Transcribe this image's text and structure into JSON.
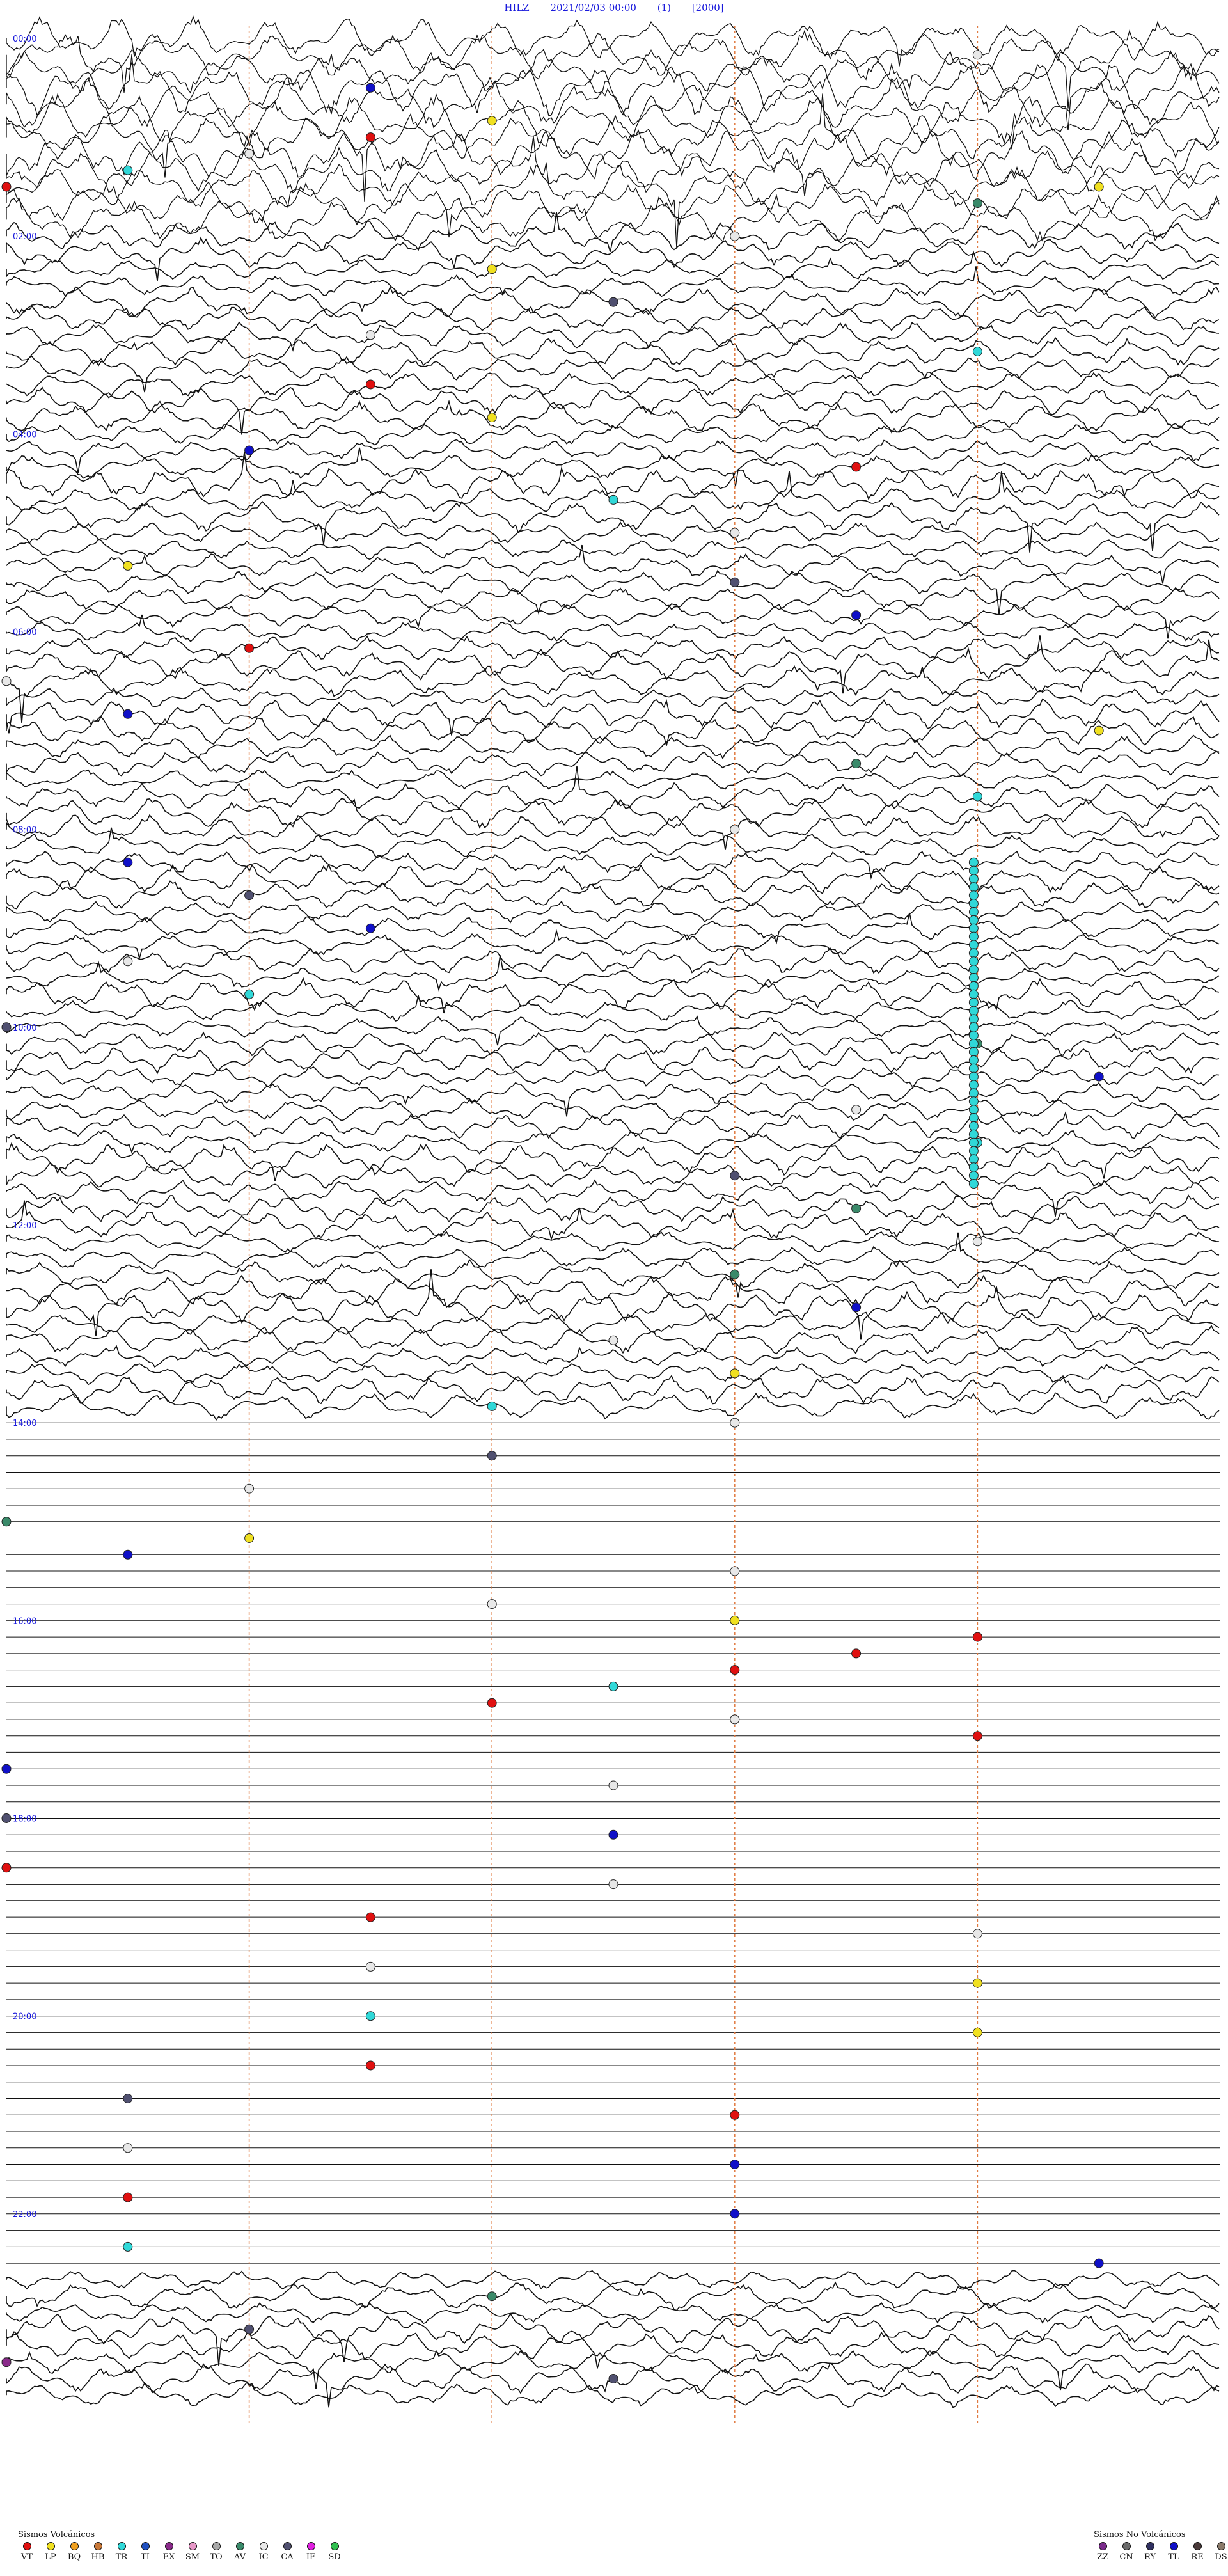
{
  "header": {
    "station": "HILZ",
    "datetime": "2021/02/03 00:00",
    "component": "(1)",
    "gain": "[2000]"
  },
  "chart_data": {
    "type": "scatter",
    "description_type": "helicorder",
    "title": "HILZ 2021/02/03 00:00 (1) [2000]",
    "rows": 144,
    "minutes_per_row": 10,
    "time_labels": [
      "00:00",
      "02:00",
      "04:00",
      "06:00",
      "08:00",
      "10:00",
      "12:00",
      "14:00",
      "16:00",
      "18:00",
      "20:00",
      "22:00"
    ],
    "time_label_color": "#1a1adc",
    "minute_marker_positions": [
      0.2,
      0.4,
      0.6,
      0.8
    ],
    "minute_marker_color": "#e07a40",
    "trace_color": "#111111",
    "active_trace_hours": [
      [
        0,
        14
      ],
      [
        22.6,
        24
      ]
    ],
    "flat_trace_hours": [
      14,
      22.6
    ],
    "event_counts_by_class": {
      "VT": 33,
      "LP": 20,
      "BQ": 0,
      "HB": 0,
      "TR": 95,
      "TI": 0,
      "EX": 2,
      "SM": 0,
      "TO": 0,
      "AV": 9,
      "IC": 54,
      "CA": 10,
      "IF": 0,
      "SD": 0,
      "ZZ": 0,
      "CN": 0,
      "RY": 0,
      "TL": 18,
      "RE": 0,
      "DS": 0
    },
    "events": [
      {
        "t": 0.3,
        "cls": "IC"
      },
      {
        "t": 0.55,
        "cls": "TL"
      },
      {
        "t": 0.9,
        "cls": "LP"
      },
      {
        "t": 1.05,
        "cls": "VT"
      },
      {
        "t": 1.2,
        "cls": "IC"
      },
      {
        "t": 1.35,
        "cls": "TR"
      },
      {
        "t": 1.5,
        "cls": "VT"
      },
      {
        "t": 1.65,
        "cls": "LP"
      },
      {
        "t": 1.8,
        "cls": "AV"
      },
      {
        "t": 2.1,
        "cls": "IC"
      },
      {
        "t": 2.4,
        "cls": "LP"
      },
      {
        "t": 2.75,
        "cls": "CA"
      },
      {
        "t": 3.05,
        "cls": "IC"
      },
      {
        "t": 3.3,
        "cls": "TR"
      },
      {
        "t": 3.55,
        "cls": "VT"
      },
      {
        "t": 3.9,
        "cls": "LP"
      },
      {
        "t": 4.2,
        "cls": "TL"
      },
      {
        "t": 4.45,
        "cls": "VT"
      },
      {
        "t": 4.75,
        "cls": "TR"
      },
      {
        "t": 5.1,
        "cls": "IC"
      },
      {
        "t": 5.35,
        "cls": "LP"
      },
      {
        "t": 5.6,
        "cls": "CA"
      },
      {
        "t": 5.95,
        "cls": "TL"
      },
      {
        "t": 6.2,
        "cls": "VT"
      },
      {
        "t": 6.5,
        "cls": "IC"
      },
      {
        "t": 6.85,
        "cls": "TL"
      },
      {
        "t": 7.15,
        "cls": "LP"
      },
      {
        "t": 7.45,
        "cls": "AV"
      },
      {
        "t": 7.8,
        "cls": "TR"
      },
      {
        "t": 8.1,
        "cls": "IC"
      },
      {
        "t": 8.35,
        "cls": "TL"
      },
      {
        "t": 8.7,
        "cls": "CA"
      },
      {
        "t": 9.05,
        "cls": "TL"
      },
      {
        "t": 9.35,
        "cls": "IC"
      },
      {
        "t": 9.7,
        "cls": "TR"
      },
      {
        "t": 10.0,
        "cls": "CA"
      },
      {
        "t": 10.3,
        "cls": "AV"
      },
      {
        "t": 10.65,
        "cls": "TL"
      },
      {
        "t": 10.95,
        "cls": "IC"
      },
      {
        "t": 11.3,
        "cls": "TR"
      },
      {
        "t": 11.6,
        "cls": "CA"
      },
      {
        "t": 11.95,
        "cls": "AV"
      },
      {
        "t": 12.3,
        "cls": "IC"
      },
      {
        "t": 12.6,
        "cls": "AV"
      },
      {
        "t": 12.95,
        "cls": "TL"
      },
      {
        "t": 13.25,
        "cls": "IC"
      },
      {
        "t": 13.6,
        "cls": "LP"
      },
      {
        "t": 13.9,
        "cls": "TR"
      },
      {
        "t": 14.1,
        "cls": "IC"
      },
      {
        "t": 14.4,
        "cls": "CA"
      },
      {
        "t": 14.7,
        "cls": "IC"
      },
      {
        "t": 15.0,
        "cls": "AV"
      },
      {
        "t": 15.2,
        "cls": "LP"
      },
      {
        "t": 15.35,
        "cls": "TL"
      },
      {
        "t": 15.6,
        "cls": "IC"
      },
      {
        "t": 15.9,
        "cls": "IC"
      },
      {
        "t": 16.1,
        "cls": "LP"
      },
      {
        "t": 16.3,
        "cls": "VT"
      },
      {
        "t": 16.45,
        "cls": "VT"
      },
      {
        "t": 16.6,
        "cls": "VT"
      },
      {
        "t": 16.75,
        "cls": "TR"
      },
      {
        "t": 16.9,
        "cls": "VT"
      },
      {
        "t": 17.1,
        "cls": "IC"
      },
      {
        "t": 17.3,
        "cls": "VT"
      },
      {
        "t": 17.5,
        "cls": "TL"
      },
      {
        "t": 17.75,
        "cls": "IC"
      },
      {
        "t": 18.0,
        "cls": "CA"
      },
      {
        "t": 18.25,
        "cls": "TL"
      },
      {
        "t": 18.5,
        "cls": "VT"
      },
      {
        "t": 18.75,
        "cls": "IC"
      },
      {
        "t": 19.05,
        "cls": "VT"
      },
      {
        "t": 19.3,
        "cls": "IC"
      },
      {
        "t": 19.55,
        "cls": "IC"
      },
      {
        "t": 19.8,
        "cls": "LP"
      },
      {
        "t": 20.05,
        "cls": "TR"
      },
      {
        "t": 20.3,
        "cls": "LP"
      },
      {
        "t": 20.55,
        "cls": "VT"
      },
      {
        "t": 20.85,
        "cls": "CA"
      },
      {
        "t": 21.1,
        "cls": "VT"
      },
      {
        "t": 21.35,
        "cls": "IC"
      },
      {
        "t": 21.6,
        "cls": "TL"
      },
      {
        "t": 21.85,
        "cls": "VT"
      },
      {
        "t": 22.1,
        "cls": "TL"
      },
      {
        "t": 22.35,
        "cls": "TR"
      },
      {
        "t": 22.65,
        "cls": "TL"
      },
      {
        "t": 22.9,
        "cls": "AV"
      },
      {
        "t": 23.2,
        "cls": "CA"
      },
      {
        "t": 23.5,
        "cls": "EX"
      },
      {
        "t": 23.75,
        "cls": "CA"
      }
    ]
  },
  "legend_volcanic": {
    "title": "Sismos Volcánicos",
    "items": [
      {
        "label": "VT",
        "color": "#e01010"
      },
      {
        "label": "LP",
        "color": "#f0e020"
      },
      {
        "label": "BQ",
        "color": "#f0a020"
      },
      {
        "label": "HB",
        "color": "#c87838"
      },
      {
        "label": "TR",
        "color": "#30d8d8"
      },
      {
        "label": "TI",
        "color": "#2050c0"
      },
      {
        "label": "EX",
        "color": "#8a2a8a"
      },
      {
        "label": "SM",
        "color": "#e898c8"
      },
      {
        "label": "TO",
        "color": "#a8a8a8"
      },
      {
        "label": "AV",
        "color": "#3a8a6a"
      },
      {
        "label": "IC",
        "color": "#e8e8e8"
      },
      {
        "label": "CA",
        "color": "#505070"
      },
      {
        "label": "IF",
        "color": "#e020e0"
      },
      {
        "label": "SD",
        "color": "#30c050"
      }
    ]
  },
  "legend_nonvolcanic": {
    "title": "Sismos No Volcánicos",
    "items": [
      {
        "label": "ZZ",
        "color": "#7a2a8a"
      },
      {
        "label": "CN",
        "color": "#6a6a6a"
      },
      {
        "label": "RY",
        "color": "#303060"
      },
      {
        "label": "TL",
        "color": "#1010c8"
      },
      {
        "label": "RE",
        "color": "#4a3a3a"
      },
      {
        "label": "DS",
        "color": "#8a7a6a"
      }
    ]
  }
}
